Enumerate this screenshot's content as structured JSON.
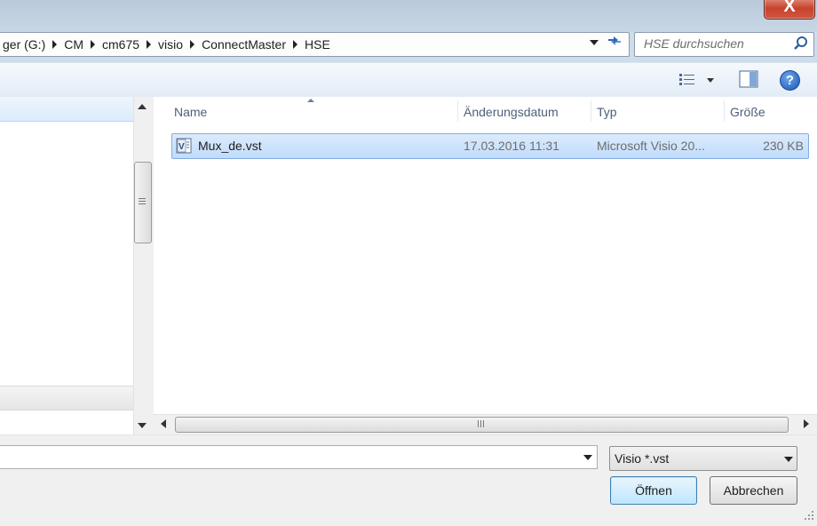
{
  "window": {
    "close_glyph": "X"
  },
  "address_bar": {
    "crumbs": [
      "ger (G:)",
      "CM",
      "cm675",
      "visio",
      "ConnectMaster",
      "HSE"
    ]
  },
  "search": {
    "placeholder": "HSE durchsuchen"
  },
  "toolbar": {
    "view_icon": "details-view-icon",
    "preview_icon": "preview-pane-icon",
    "help_label": "?"
  },
  "file_list": {
    "columns": [
      "Name",
      "Änderungsdatum",
      "Typ",
      "Größe"
    ],
    "sorted_column": "Name",
    "rows": [
      {
        "name": "Mux_de.vst",
        "modified": "17.03.2016 11:31",
        "type": "Microsoft Visio 20...",
        "size": "230 KB",
        "selected": true,
        "icon": "visio-file-icon"
      }
    ]
  },
  "footer": {
    "filename_value": "",
    "filetype_value": "Visio *.vst",
    "open_label": "Öffnen",
    "cancel_label": "Abbrechen"
  },
  "colors": {
    "selection_bg": "#cce4fc",
    "selection_border": "#84acdd",
    "header_text": "#4c607a",
    "close_red": "#c7422c"
  }
}
